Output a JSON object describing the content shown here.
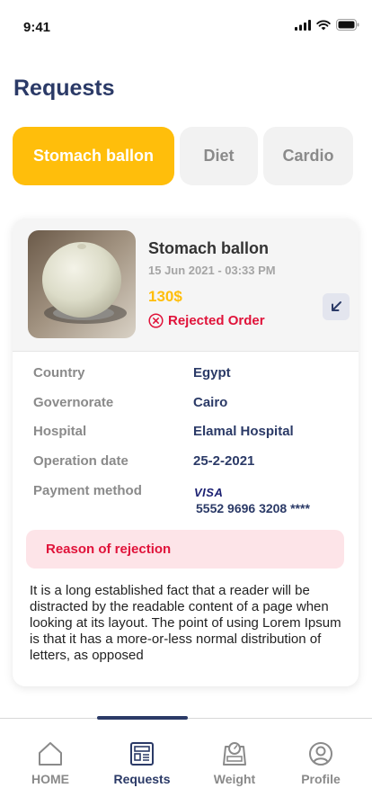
{
  "status_bar": {
    "time": "9:41"
  },
  "page": {
    "title": "Requests"
  },
  "tabs": [
    {
      "label": "Stomach ballon",
      "active": true
    },
    {
      "label": "Diet",
      "active": false
    },
    {
      "label": "Cardio",
      "active": false
    }
  ],
  "request": {
    "name": "Stomach ballon",
    "date": "15 Jun 2021 - 03:33 PM",
    "price": "130$",
    "status": "Rejected Order",
    "details": {
      "country_label": "Country",
      "country": "Egypt",
      "governorate_label": "Governorate",
      "governorate": "Cairo",
      "hospital_label": "Hospital",
      "hospital": "Elamal Hospital",
      "operation_date_label": "Operation date",
      "operation_date": "25-2-2021",
      "payment_label": "Payment method",
      "card_brand": "VISA",
      "card_number": "5552 9696 3208 ****"
    },
    "rejection_title": "Reason of rejection",
    "rejection_text": "It is a long established fact that a reader will be distracted by the readable content of a page when looking at its layout. The point of using Lorem Ipsum is that it has a more-or-less normal distribution of letters, as opposed"
  },
  "bottom_nav": [
    {
      "label": "HOME",
      "icon": "home-icon",
      "active": false
    },
    {
      "label": "Requests",
      "icon": "requests-icon",
      "active": true
    },
    {
      "label": "Weight",
      "icon": "weight-scale-icon",
      "active": false
    },
    {
      "label": "Profile",
      "icon": "profile-icon",
      "active": false
    }
  ],
  "colors": {
    "primary": "#2b3a67",
    "accent": "#ffbe0b",
    "danger": "#e0133a"
  }
}
